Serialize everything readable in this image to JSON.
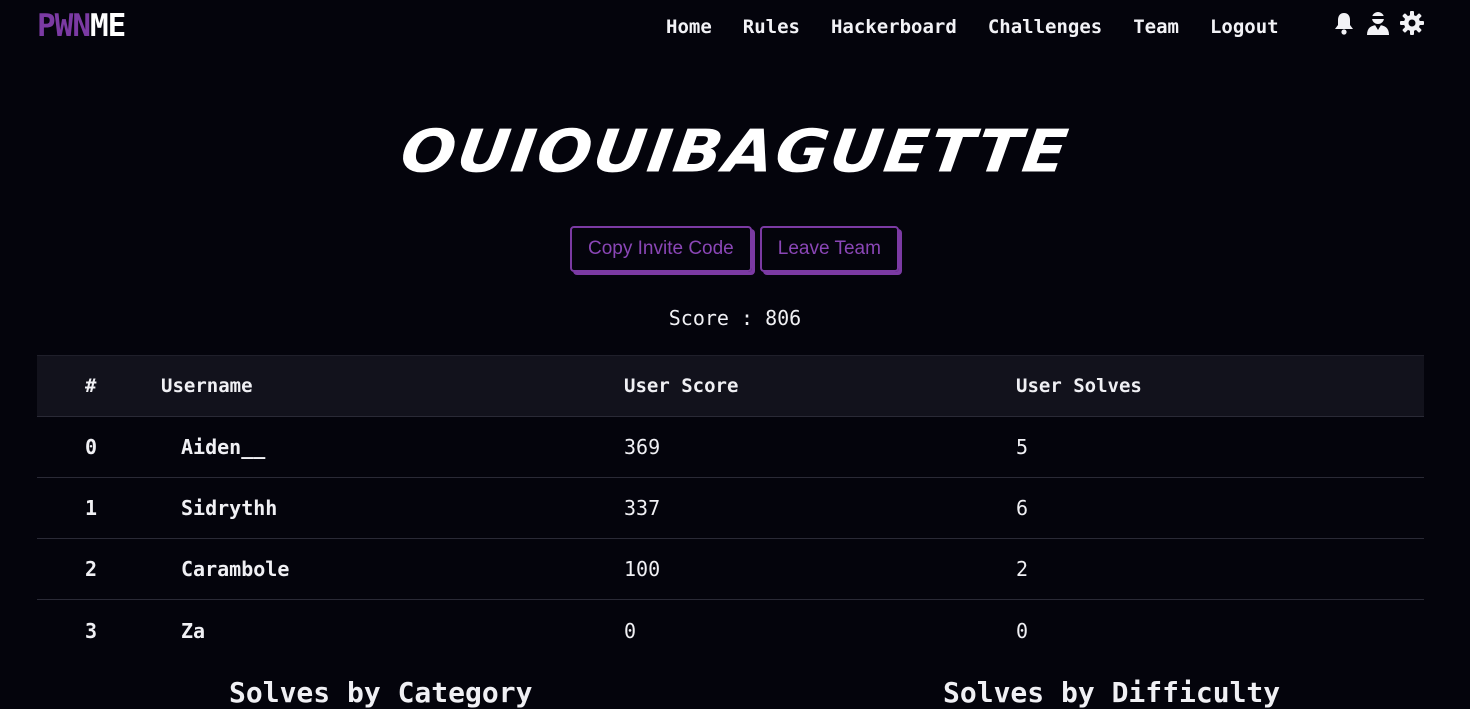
{
  "nav": {
    "logo_part1": "PWN",
    "logo_part2": "ME",
    "links": [
      "Home",
      "Rules",
      "Hackerboard",
      "Challenges",
      "Team",
      "Logout"
    ],
    "icons": [
      "bell-icon",
      "user-icon",
      "gear-icon"
    ]
  },
  "team": {
    "name": "OUIOUIBAGUETTE",
    "copy_invite_label": "Copy Invite Code",
    "leave_team_label": "Leave Team",
    "score_text": "Score : 806"
  },
  "table": {
    "headers": [
      "#",
      "Username",
      "User Score",
      "User Solves"
    ],
    "rows": [
      {
        "rank": "0",
        "username": "Aiden__",
        "score": "369",
        "solves": "5"
      },
      {
        "rank": "1",
        "username": "Sidrythh",
        "score": "337",
        "solves": "6"
      },
      {
        "rank": "2",
        "username": "Carambole",
        "score": "100",
        "solves": "2"
      },
      {
        "rank": "3",
        "username": "Za",
        "score": "0",
        "solves": "0"
      }
    ]
  },
  "bottom": {
    "left_heading": "Solves by Category",
    "right_heading": "Solves by Difficulty"
  },
  "colors": {
    "accent": "#7b3aa3",
    "background": "#04040c",
    "table_header_bg": "#12121c"
  }
}
